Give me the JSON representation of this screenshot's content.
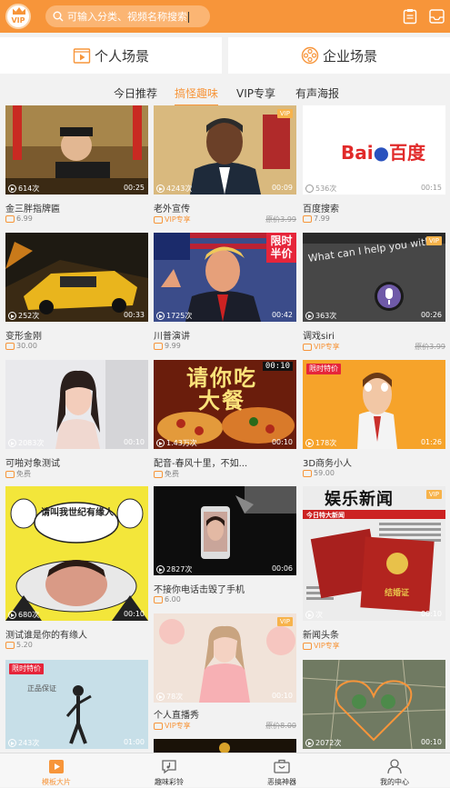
{
  "header": {
    "search_placeholder": "可输入分类、视频名称搜索",
    "avatar_badge": "VIP",
    "accent": "#f7953a"
  },
  "scene_buttons": [
    {
      "label": "个人场景"
    },
    {
      "label": "企业场景"
    }
  ],
  "tabs": [
    {
      "label": "今日推荐",
      "active": false
    },
    {
      "label": "搞怪趣味",
      "active": true
    },
    {
      "label": "VIP专享",
      "active": false
    },
    {
      "label": "有声海报",
      "active": false
    }
  ],
  "cards": [
    {
      "title": "金三胖指牌匾",
      "views": "614次",
      "duration": "00:25",
      "price": "6.99"
    },
    {
      "title": "老外宣传",
      "views": "4243次",
      "duration": "00:09",
      "price": "VIP专享",
      "old_price": "原价3.99",
      "tag": "VIP"
    },
    {
      "title": "百度搜索",
      "views": "536次",
      "duration": "00:15",
      "price": "7.99",
      "logo_text": "百度"
    },
    {
      "title": "变形金刚",
      "views": "252次",
      "duration": "00:33",
      "price": "30.00"
    },
    {
      "title": "川普演讲",
      "views": "1725次",
      "duration": "00:42",
      "price": "9.99",
      "corner_text": "限时半价"
    },
    {
      "title": "调戏siri",
      "views": "363次",
      "duration": "00:26",
      "price": "VIP专享",
      "old_price": "原价3.99",
      "tag": "VIP",
      "screen_text": "What can I help you with?"
    },
    {
      "title": "可啪对象测试",
      "views": "2083次",
      "duration": "00:10",
      "price": "免费"
    },
    {
      "title": "配音-春风十里，不如...",
      "views": "1.43万次",
      "duration": "00:10",
      "price": "免费",
      "poster_text": "请你吃大餐",
      "poster_time": "00:10"
    },
    {
      "title": "3D商务小人",
      "views": "178次",
      "duration": "01:26",
      "price": "59.00",
      "sale_tag": "限时特价"
    },
    {
      "title": "测试谁是你的有缘人",
      "views": "680次",
      "duration": "00:10",
      "price": "5.20",
      "meme_text": "请叫我世纪有缘人"
    },
    {
      "title": "不接你电话击毁了手机",
      "views": "2827次",
      "duration": "00:06",
      "price": "6.00"
    },
    {
      "title": "新闻头条",
      "views": "次",
      "duration": "00:10",
      "price": "VIP专享",
      "tag": "VIP",
      "news_head": "娱乐新闻",
      "news_sub": "今日特大新闻",
      "cert_text": "结婚证"
    },
    {
      "title": "个人直播秀",
      "views": "78次",
      "duration": "00:10",
      "price": "VIP专享",
      "old_price": "原价8.00",
      "tag": "VIP"
    },
    {
      "title": "",
      "views": "243次",
      "duration": "01:00",
      "price": "",
      "sale_tag": "限时特价",
      "scene_text": "正品保证"
    },
    {
      "title": "",
      "views": "2072次",
      "duration": "00:10",
      "price": ""
    }
  ],
  "bottom_nav": [
    {
      "label": "模板大片",
      "active": true
    },
    {
      "label": "趣味彩铃",
      "active": false
    },
    {
      "label": "恶搞神器",
      "active": false
    },
    {
      "label": "我的中心",
      "active": false
    }
  ]
}
